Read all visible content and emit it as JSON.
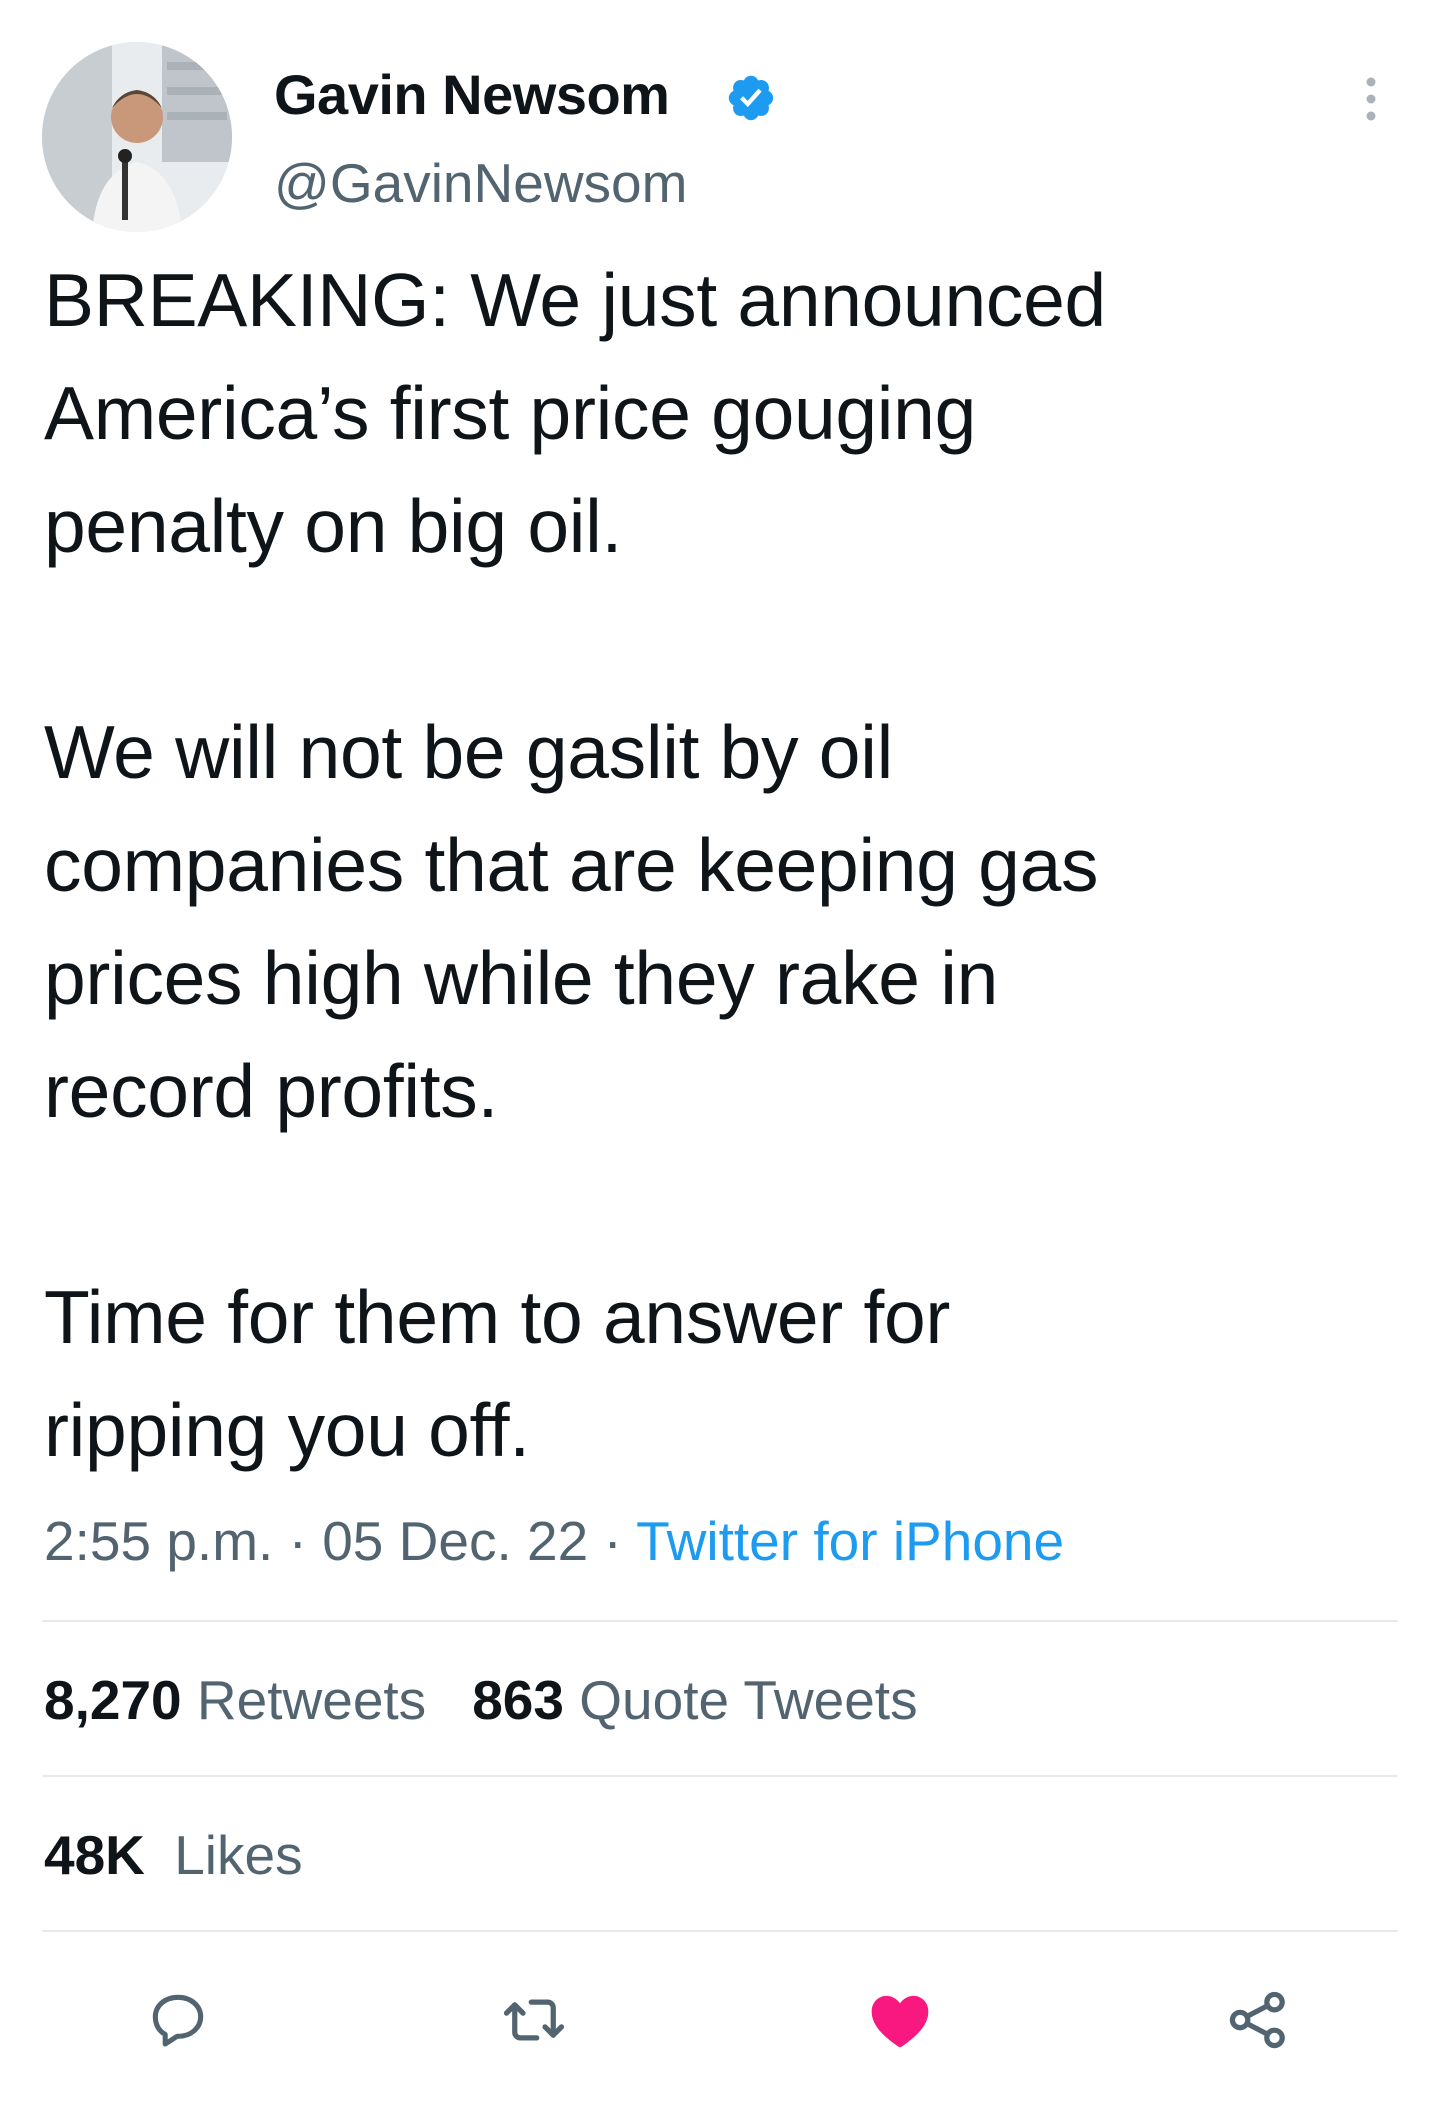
{
  "author": {
    "name": "Gavin Newsom",
    "handle": "@GavinNewsom",
    "verified_icon": "verified-badge-icon",
    "verified_color": "#1d9bf0"
  },
  "tweet": {
    "text": "BREAKING: We just announced\nAmerica’s first price gouging\npenalty on big oil.\n\nWe will not be gaslit by oil\ncompanies that are keeping gas\nprices high while they rake in\nrecord profits.\n\nTime for them to answer for\nripping you off."
  },
  "meta": {
    "time": "2:55 p.m.",
    "separator": "·",
    "date": "05 Dec. 22",
    "source": "Twitter for iPhone"
  },
  "stats": {
    "retweets_count": "8,270",
    "retweets_label": "Retweets",
    "quotes_count": "863",
    "quotes_label": "Quote Tweets",
    "likes_count": "48K",
    "likes_label": "Likes"
  },
  "actions": [
    {
      "icon": "reply-icon"
    },
    {
      "icon": "retweet-icon"
    },
    {
      "icon": "like-heart-icon",
      "state": "liked"
    },
    {
      "icon": "share-icon"
    }
  ],
  "colors": {
    "text": "#0f1419",
    "secondary": "#536471",
    "link": "#1d9bf0",
    "like": "#f91880",
    "divider": "#e6e9ea"
  }
}
